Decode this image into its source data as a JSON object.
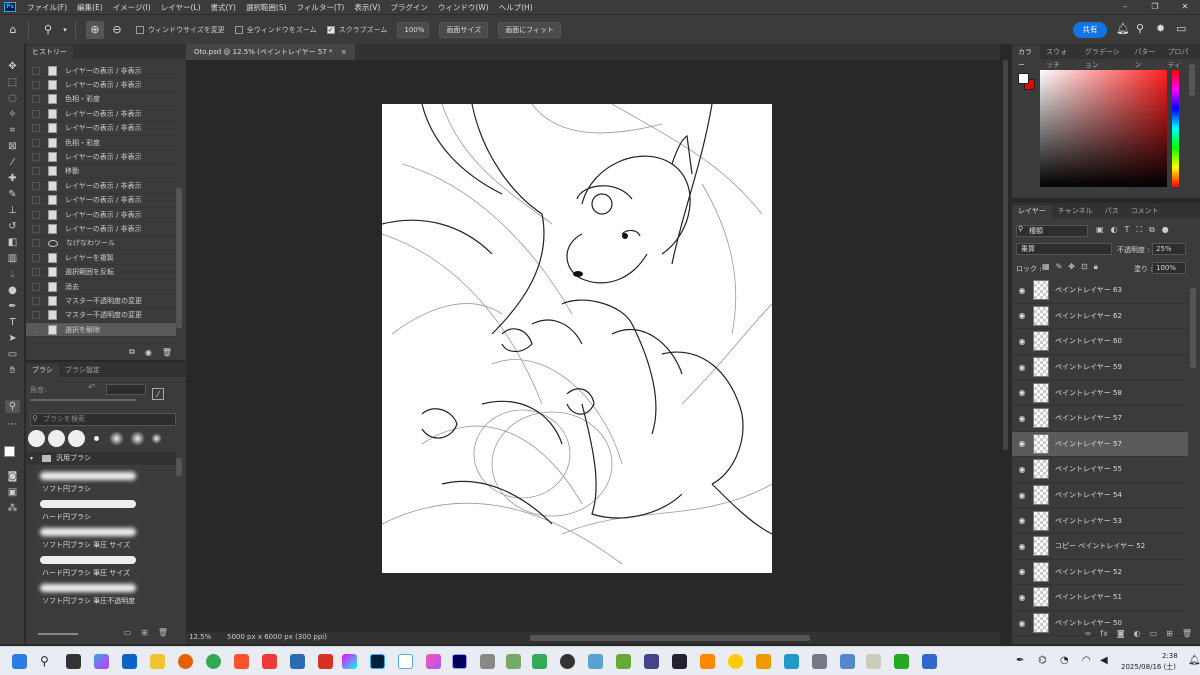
{
  "menu": {
    "app_icon": "Ps",
    "items": [
      "ファイル(F)",
      "編集(E)",
      "イメージ(I)",
      "レイヤー(L)",
      "書式(Y)",
      "選択範囲(S)",
      "フィルター(T)",
      "表示(V)",
      "プラグイン",
      "ウィンドウ(W)",
      "ヘルプ(H)"
    ],
    "window_controls": [
      "–",
      "❐",
      "✕"
    ]
  },
  "options": {
    "home_icon": "home-icon",
    "zoom_tool_icon": "zoom-tool-icon",
    "resize_windows": "ウィンドウサイズを変更",
    "zoom_all_windows": "全ウィンドウをズーム",
    "scrubby_zoom": "スクラブズーム",
    "zoom_value": "100%",
    "fit_screen": "画面サイズ",
    "fill_screen": "画面にフィット",
    "share": "共有"
  },
  "history": {
    "tabs": [
      "ヒストリー"
    ],
    "items": [
      "レイヤーの表示 / 非表示",
      "レイヤーの表示 / 非表示",
      "色相・彩度",
      "レイヤーの表示 / 非表示",
      "レイヤーの表示 / 非表示",
      "色相・彩度",
      "レイヤーの表示 / 非表示",
      "移動",
      "レイヤーの表示 / 非表示",
      "レイヤーの表示 / 非表示",
      "レイヤーの表示 / 非表示",
      "レイヤーの表示 / 非表示",
      "なげなわツール",
      "レイヤーを複製",
      "選択範囲を反転",
      "消去",
      "マスター不透明度の変更",
      "マスター不透明度の変更",
      "選択を解除"
    ],
    "selected_index": 18
  },
  "brushes": {
    "tabs": [
      "ブラシ",
      "ブラシ設定"
    ],
    "angle_label": "角度:",
    "search_placeholder": "ブラシを検索",
    "group": "汎用ブラシ",
    "items": [
      "ソフト円ブラシ",
      "ハード円ブラシ",
      "ソフト円ブラシ 筆圧 サイズ",
      "ハード円ブラシ 筆圧 サイズ",
      "ソフト円ブラシ 筆圧不透明度"
    ]
  },
  "document": {
    "tab_title": "Oto.psd @ 12.5% (ペイントレイヤー 57 *",
    "close": "×",
    "zoom": "12.5%",
    "info": "5000 px x 6000 px (300 ppi)"
  },
  "color_panel": {
    "tabs": [
      "カラー",
      "スウォッチ",
      "グラデーション",
      "パターン",
      "プロパティ"
    ],
    "foreground": "#ffffff",
    "background": "#ff0000",
    "hue_color": "#ff2020"
  },
  "layers": {
    "tabs": [
      "レイヤー",
      "チャンネル",
      "パス",
      "コメント"
    ],
    "filter": "種類",
    "blend_mode": "乗算",
    "opacity_label": "不透明度 :",
    "opacity": "25%",
    "lock_label": "ロック :",
    "fill_label": "塗り :",
    "fill": "100%",
    "items": [
      "ペイントレイヤー 63",
      "ペイントレイヤー 62",
      "ペイントレイヤー 60",
      "ペイントレイヤー 59",
      "ペイントレイヤー 58",
      "ペイントレイヤー 57",
      "ペイントレイヤー 57",
      "ペイントレイヤー 55",
      "ペイントレイヤー 54",
      "ペイントレイヤー 53",
      "コピー ペイントレイヤー 52",
      "ペイントレイヤー 52",
      "ペイントレイヤー 51",
      "ペイントレイヤー 50"
    ],
    "selected_index": 6
  },
  "taskbar": {
    "time": "2:38",
    "date": "2025/08/16 (土)"
  }
}
